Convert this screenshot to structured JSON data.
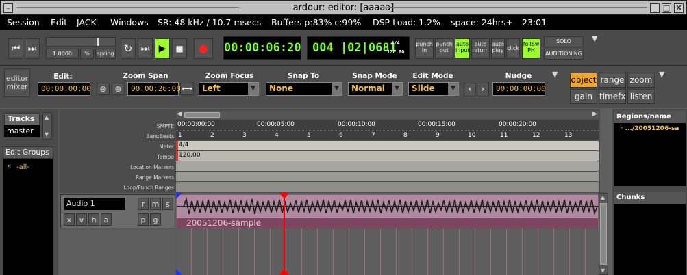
{
  "window": {
    "title": "ardour: editor: [aaaaa]"
  },
  "menubar": {
    "items": [
      "Session",
      "Edit",
      "JACK",
      "Windows"
    ],
    "sr": "SR: 48 kHz / 10.7 msecs",
    "buffers": "Buffers p:83% c:99%",
    "dsp": "DSP Load: 1.2%",
    "space": "space: 24hrs+",
    "time": "23:01"
  },
  "transport": {
    "shuttle_value": "1.0000",
    "shuttle_unit": "%",
    "shuttle_mode": "spring",
    "primary_clock": "00:00:06:20",
    "secondary_clock": "004 |02|0681",
    "meter_top": "4/4",
    "tempo_small": "120.00",
    "punch_in": [
      "punch",
      "in"
    ],
    "punch_out": [
      "punch",
      "out"
    ],
    "auto_input": [
      "auto",
      "input"
    ],
    "auto_return": [
      "auto",
      "return"
    ],
    "auto_play": [
      "auto",
      "play"
    ],
    "click": "click",
    "follow_ph": [
      "follow",
      "PH"
    ],
    "solo": "SOLO",
    "auditioning": "AUDITIONING"
  },
  "editor_toolbar": {
    "editor_mixer": [
      "editor",
      "mixer"
    ],
    "edit_label": "Edit:",
    "edit_value": "00:00:00:00",
    "zoom_span_label": "Zoom Span",
    "zoom_span_value": "00:00:26:08",
    "zoom_focus_label": "Zoom Focus",
    "zoom_focus_value": "Left",
    "snap_to_label": "Snap To",
    "snap_to_value": "None",
    "snap_mode_label": "Snap Mode",
    "snap_mode_value": "Normal",
    "edit_mode_label": "Edit Mode",
    "edit_mode_value": "Slide",
    "nudge_label": "Nudge",
    "nudge_value": "00:00:00:00",
    "modes": [
      "object",
      "range",
      "zoom",
      "gain",
      "timefx",
      "listen"
    ]
  },
  "left_panel": {
    "tracks_tab": "Tracks",
    "master": "master",
    "edit_groups": "Edit Groups",
    "all_marker": "×",
    "all": "-all-"
  },
  "rulers": {
    "labels": [
      "SMPTE",
      "Bars:Beats",
      "Meter",
      "Tempo",
      "Location Markers",
      "Range Markers",
      "Loop/Punch Ranges"
    ],
    "smpte_ticks": [
      "00:00:00:00",
      "00:00:05:00",
      "00:00:10:00",
      "00:00:15:00",
      "00:00:20:00"
    ],
    "bar_ticks": [
      "1",
      "2",
      "3",
      "4",
      "5",
      "6",
      "7",
      "8",
      "9",
      "10",
      "11",
      "12",
      "13"
    ],
    "meter": "4/4",
    "tempo": "120.00"
  },
  "track": {
    "name": "Audio 1",
    "buttons_top": [
      "r",
      "m",
      "s"
    ],
    "buttons_bottom": [
      "x",
      "v",
      "h",
      "a"
    ],
    "buttons_pg": [
      "p",
      "g"
    ],
    "region_name": "20051206-sample"
  },
  "right_panel": {
    "regions_title": "Regions/name",
    "region_item": ".../20051206-sa",
    "chunks_title": "Chunks"
  },
  "colors": {
    "clock_green": "#7cff30",
    "highlight_green": "#9cff2a",
    "field_amber": "#f2c14a",
    "object_btn": "#f5a623",
    "playhead": "#ff0000",
    "region_bg": "#b08aa0"
  }
}
